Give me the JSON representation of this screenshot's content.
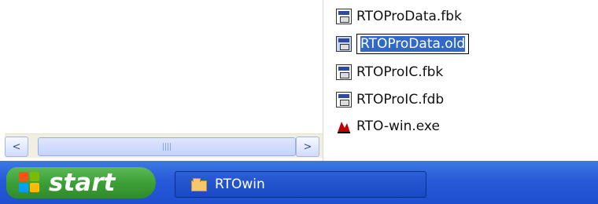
{
  "left_panel": {},
  "files": [
    {
      "name": "RTOProData.fbk",
      "icon": "firebird-file-icon"
    },
    {
      "name": "RTOProData.old",
      "icon": "firebird-file-icon",
      "renaming": true
    },
    {
      "name": "RTOProIC.fbk",
      "icon": "firebird-file-icon"
    },
    {
      "name": "RTOProIC.fdb",
      "icon": "firebird-file-icon"
    },
    {
      "name": "RTO-win.exe",
      "icon": "rto-app-icon"
    }
  ],
  "taskbar": {
    "start_label": "start",
    "window_label": "RTOwin"
  },
  "colors": {
    "taskbar_blue": "#2859d9",
    "start_green": "#3d9f37",
    "selection_blue": "#316ac5"
  }
}
